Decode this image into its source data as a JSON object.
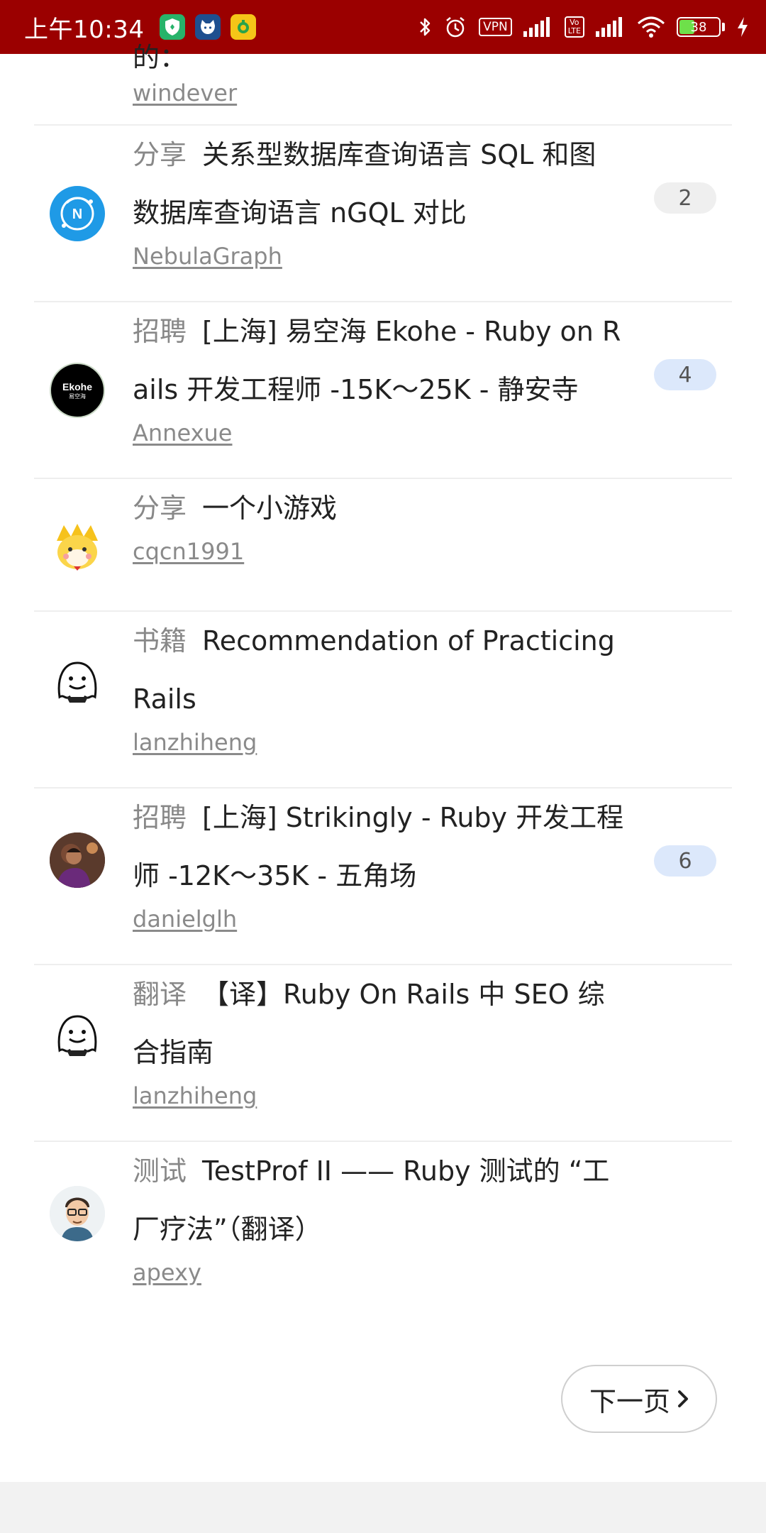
{
  "status_bar": {
    "time": "上午10:34",
    "vpn": "VPN",
    "volte": "Vo\nLTE",
    "battery": "38",
    "battery_level_percent": 38
  },
  "partial_topic": {
    "title_fragment": "的：",
    "user": "windever"
  },
  "topics": [
    {
      "node": "分享",
      "title_line1": "关系型数据库查询语言 SQL 和图",
      "title_line2": "数据库查询语言 nGQL 对比",
      "user": "NebulaGraph",
      "replies": "2",
      "badge": "gray",
      "avatar_icon": "nebula-graph-logo-icon"
    },
    {
      "node": "招聘",
      "title_line1": "[上海] 易空海 Ekohe - Ruby on R",
      "title_line2": "ails 开发工程师 -15K～25K - 静安寺",
      "user": "Annexue",
      "replies": "4",
      "badge": "blue",
      "avatar_icon": "ekohe-logo-icon",
      "avatar_text": "Ekohe",
      "avatar_subtext": "易空海"
    },
    {
      "node": "分享",
      "title_line1": "一个小游戏",
      "title_line2": "",
      "user": "cqcn1991",
      "replies": "",
      "badge": "",
      "avatar_icon": "cartoon-tiger-icon"
    },
    {
      "node": "书籍",
      "title_line1": "Recommendation of Practicing",
      "title_line2": "Rails",
      "user": "lanzhiheng",
      "replies": "",
      "badge": "",
      "avatar_icon": "ghost-doodle-icon"
    },
    {
      "node": "招聘",
      "title_line1": "[上海] Strikingly - Ruby 开发工程",
      "title_line2": "师 -12K～35K - 五角场",
      "user": "danielglh",
      "replies": "6",
      "badge": "blue",
      "avatar_icon": "user-photo-icon"
    },
    {
      "node": "翻译",
      "title_line1": "【译】Ruby On Rails 中 SEO 综",
      "title_line2": "合指南",
      "user": "lanzhiheng",
      "replies": "",
      "badge": "",
      "avatar_icon": "ghost-doodle-icon"
    },
    {
      "node": "测试",
      "title_line1": "TestProf II —— Ruby 测试的 “工",
      "title_line2": "厂疗法”（翻译）",
      "user": "apexy",
      "replies": "",
      "badge": "",
      "avatar_icon": "cartoon-man-glasses-icon"
    }
  ],
  "pagination": {
    "next_label": "下一页"
  },
  "colors": {
    "status_bar": "#9b0000",
    "badge_gray": "#efefef",
    "badge_blue": "#dce8fb",
    "divider": "#eeeeee"
  }
}
